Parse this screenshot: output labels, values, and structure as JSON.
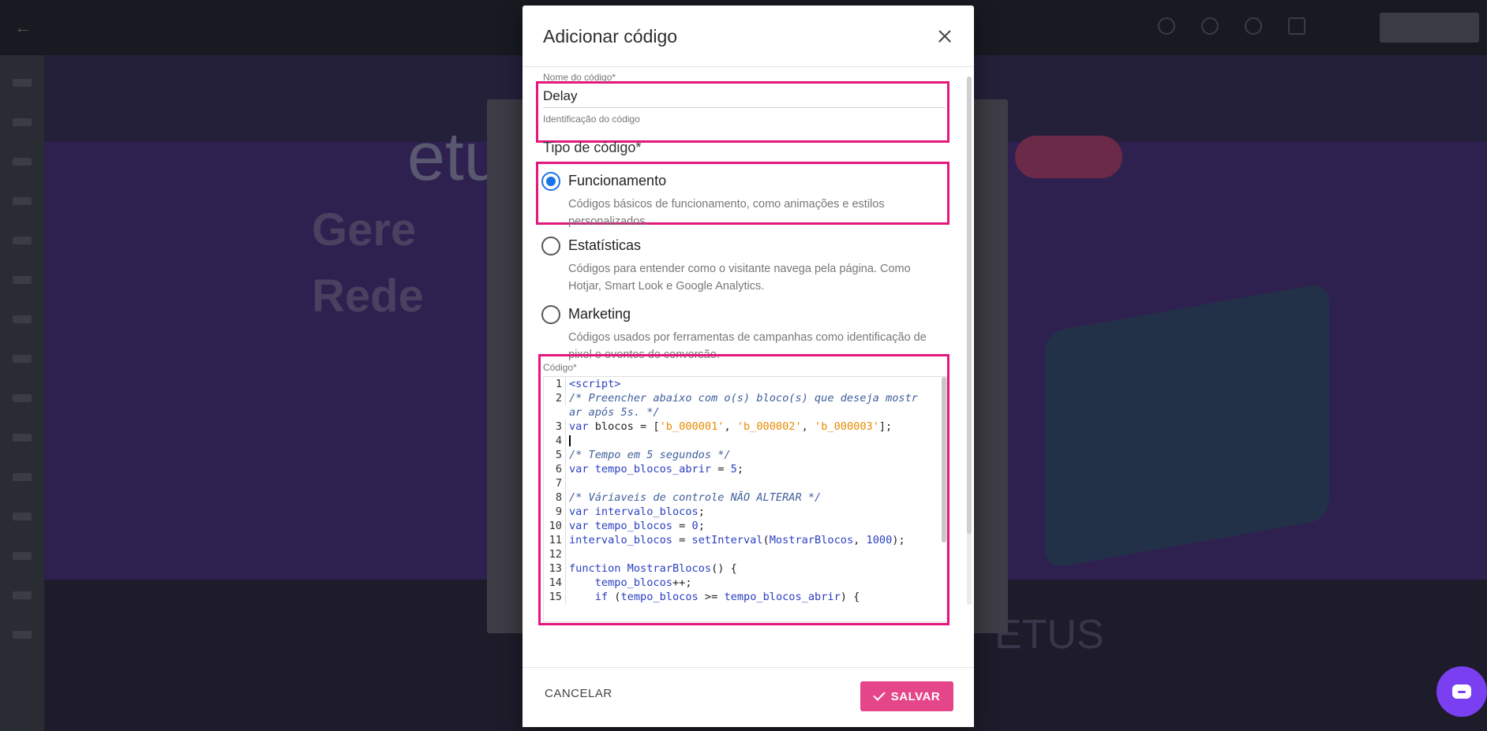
{
  "modal": {
    "title": "Adicionar código",
    "name_field": {
      "label": "Nome do código*",
      "value": "Delay",
      "helper": "Identificação do código"
    },
    "type_section": {
      "title": "Tipo de código*",
      "options": [
        {
          "label": "Funcionamento",
          "description": "Códigos básicos de funcionamento, como animações e estilos personalizados.",
          "checked": true
        },
        {
          "label": "Estatísticas",
          "description": "Códigos para entender como o visitante navega pela página. Como Hotjar, Smart Look e Google Analytics.",
          "checked": false
        },
        {
          "label": "Marketing",
          "description": "Códigos usados por ferramentas de campanhas como identificação de pixel e eventos de conversão.",
          "checked": false
        }
      ]
    },
    "code_field": {
      "label": "Código*"
    },
    "footer": {
      "cancel_label": "CANCELAR",
      "save_label": "SALVAR"
    }
  },
  "code_editor": {
    "lines": [
      {
        "n": "1",
        "tokens": [
          [
            "tag",
            "<script>"
          ]
        ]
      },
      {
        "n": "2",
        "tokens": [
          [
            "cmt",
            "/* Preencher abaixo com o(s) bloco(s) que deseja mostr"
          ]
        ]
      },
      {
        "n": "",
        "tokens": [
          [
            "cmt",
            "ar após 5s. */"
          ]
        ]
      },
      {
        "n": "3",
        "tokens": [
          [
            "kw",
            "var "
          ],
          [
            "plain",
            "blocos = ["
          ],
          [
            "str",
            "'b_000001'"
          ],
          [
            "plain",
            ", "
          ],
          [
            "str",
            "'b_000002'"
          ],
          [
            "plain",
            ", "
          ],
          [
            "str",
            "'b_000003'"
          ],
          [
            "plain",
            "];"
          ]
        ]
      },
      {
        "n": "4",
        "tokens": [
          [
            "caret",
            ""
          ]
        ]
      },
      {
        "n": "5",
        "tokens": [
          [
            "cmt",
            "/* Tempo em 5 segundos */"
          ]
        ]
      },
      {
        "n": "6",
        "tokens": [
          [
            "kw",
            "var "
          ],
          [
            "kw",
            "tempo_blocos_abrir"
          ],
          [
            "plain",
            " = "
          ],
          [
            "num",
            "5"
          ],
          [
            "plain",
            ";"
          ]
        ]
      },
      {
        "n": "7",
        "tokens": []
      },
      {
        "n": "8",
        "tokens": [
          [
            "cmt",
            "/* Váriaveis de controle NÃO ALTERAR */"
          ]
        ]
      },
      {
        "n": "9",
        "tokens": [
          [
            "kw",
            "var "
          ],
          [
            "kw",
            "intervalo_blocos"
          ],
          [
            "plain",
            ";"
          ]
        ]
      },
      {
        "n": "10",
        "tokens": [
          [
            "kw",
            "var "
          ],
          [
            "kw",
            "tempo_blocos"
          ],
          [
            "plain",
            " = "
          ],
          [
            "num",
            "0"
          ],
          [
            "plain",
            ";"
          ]
        ]
      },
      {
        "n": "11",
        "tokens": [
          [
            "kw",
            "intervalo_blocos"
          ],
          [
            "plain",
            " = "
          ],
          [
            "kw",
            "setInterval"
          ],
          [
            "plain",
            "("
          ],
          [
            "kw",
            "MostrarBlocos"
          ],
          [
            "plain",
            ", "
          ],
          [
            "num",
            "1000"
          ],
          [
            "plain",
            ");"
          ]
        ]
      },
      {
        "n": "12",
        "tokens": []
      },
      {
        "n": "13",
        "tokens": [
          [
            "kw",
            "function "
          ],
          [
            "kw",
            "MostrarBlocos"
          ],
          [
            "plain",
            "() {"
          ]
        ]
      },
      {
        "n": "14",
        "tokens": [
          [
            "plain",
            "    "
          ],
          [
            "kw",
            "tempo_blocos"
          ],
          [
            "plain",
            "++;"
          ]
        ]
      },
      {
        "n": "15",
        "tokens": [
          [
            "plain",
            "    "
          ],
          [
            "kw",
            "if"
          ],
          [
            "plain",
            " ("
          ],
          [
            "kw",
            "tempo_blocos"
          ],
          [
            "plain",
            " >= "
          ],
          [
            "kw",
            "tempo_blocos_abrir"
          ],
          [
            "plain",
            ") {"
          ]
        ]
      }
    ]
  },
  "background": {
    "hero_title_line1": "Gere",
    "hero_title_line2": "Rede",
    "logo_text": "etus",
    "footer_logo_text": "ETUS"
  },
  "colors": {
    "highlight": "#e5177d",
    "save_button": "#e5468a",
    "radio_selected": "#1a73e8",
    "chat_fab": "#7a3ff0"
  }
}
